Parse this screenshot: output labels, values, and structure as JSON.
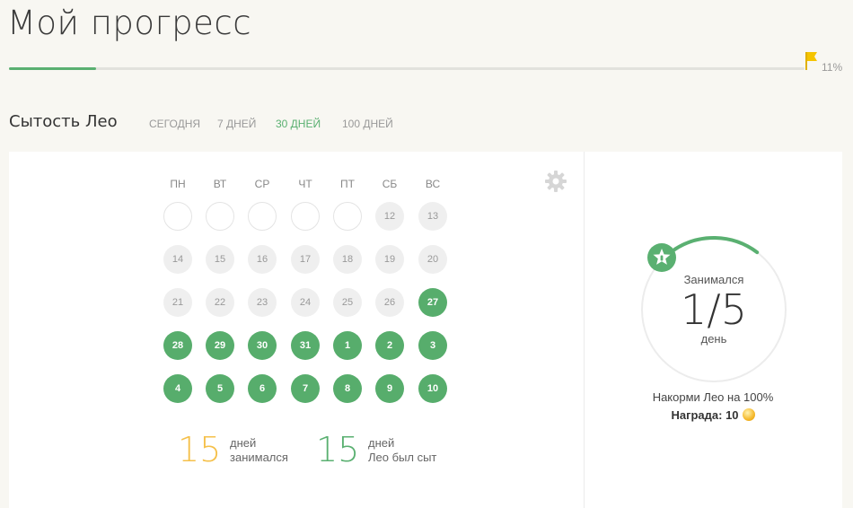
{
  "header": {
    "title": "Мой прогресс",
    "progress_percent": 11,
    "progress_label": "11%",
    "accent_color": "#5ab071",
    "flag_color": "#f5c400"
  },
  "section": {
    "title": "Сытость Лео",
    "tabs": [
      {
        "label": "СЕГОДНЯ",
        "active": false
      },
      {
        "label": "7 ДНЕЙ",
        "active": false
      },
      {
        "label": "30 ДНЕЙ",
        "active": true
      },
      {
        "label": "100 ДНЕЙ",
        "active": false
      }
    ]
  },
  "calendar": {
    "weekdays": [
      "ПН",
      "ВТ",
      "СР",
      "ЧТ",
      "ПТ",
      "СБ",
      "ВС"
    ],
    "weeks": [
      [
        {
          "d": "",
          "s": "empty"
        },
        {
          "d": "",
          "s": "empty"
        },
        {
          "d": "",
          "s": "empty"
        },
        {
          "d": "",
          "s": "empty"
        },
        {
          "d": "",
          "s": "empty"
        },
        {
          "d": "12",
          "s": "gray"
        },
        {
          "d": "13",
          "s": "gray"
        }
      ],
      [
        {
          "d": "14",
          "s": "gray"
        },
        {
          "d": "15",
          "s": "gray"
        },
        {
          "d": "16",
          "s": "gray"
        },
        {
          "d": "17",
          "s": "gray"
        },
        {
          "d": "18",
          "s": "gray"
        },
        {
          "d": "19",
          "s": "gray"
        },
        {
          "d": "20",
          "s": "gray"
        }
      ],
      [
        {
          "d": "21",
          "s": "gray"
        },
        {
          "d": "22",
          "s": "gray"
        },
        {
          "d": "23",
          "s": "gray"
        },
        {
          "d": "24",
          "s": "gray"
        },
        {
          "d": "25",
          "s": "gray"
        },
        {
          "d": "26",
          "s": "gray"
        },
        {
          "d": "27",
          "s": "green"
        }
      ],
      [
        {
          "d": "28",
          "s": "green"
        },
        {
          "d": "29",
          "s": "green"
        },
        {
          "d": "30",
          "s": "green"
        },
        {
          "d": "31",
          "s": "green"
        },
        {
          "d": "1",
          "s": "green"
        },
        {
          "d": "2",
          "s": "green"
        },
        {
          "d": "3",
          "s": "green"
        }
      ],
      [
        {
          "d": "4",
          "s": "green"
        },
        {
          "d": "5",
          "s": "green"
        },
        {
          "d": "6",
          "s": "green"
        },
        {
          "d": "7",
          "s": "green"
        },
        {
          "d": "8",
          "s": "green"
        },
        {
          "d": "9",
          "s": "green"
        },
        {
          "d": "10",
          "s": "green"
        }
      ]
    ]
  },
  "stats": {
    "studied": {
      "value": "15",
      "line1": "дней",
      "line2": "занимался",
      "color": "#f5c04a"
    },
    "fed": {
      "value": "15",
      "line1": "дней",
      "line2": "Лео был сыт",
      "color": "#5ab071"
    }
  },
  "daily_goal": {
    "caption_top": "Занимался",
    "value": "1/5",
    "caption_bottom": "день",
    "progress_fraction": 0.2,
    "goal_text": "Накорми Лео на 100%",
    "reward_label": "Награда: 10",
    "icons": [
      "star-icon",
      "coin-icon",
      "gear-icon",
      "flag-icon"
    ]
  }
}
